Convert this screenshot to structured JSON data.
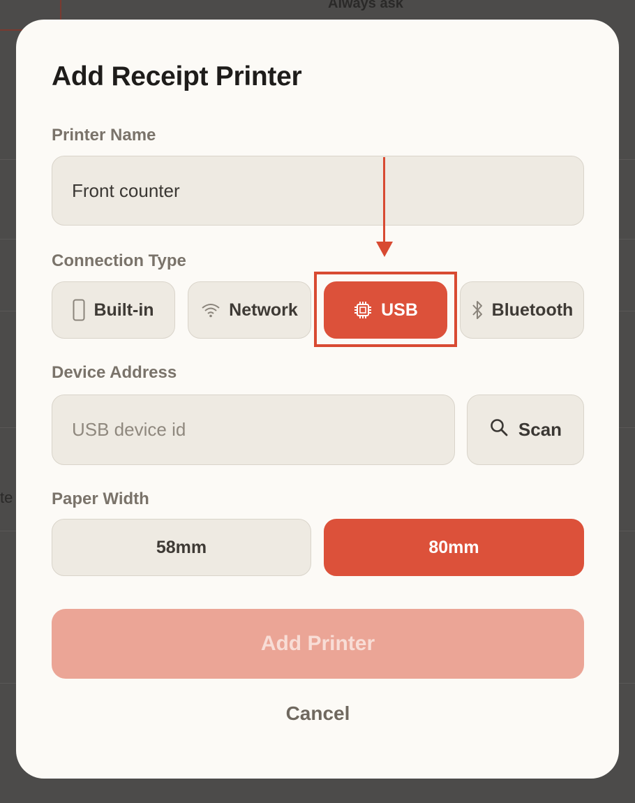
{
  "background": {
    "top_text": "Always ask"
  },
  "dialog": {
    "title": "Add Receipt Printer",
    "printer_name": {
      "label": "Printer Name",
      "value": "Front counter"
    },
    "connection_type": {
      "label": "Connection Type",
      "options": [
        {
          "label": "Built-in",
          "icon": "phone-icon",
          "selected": false
        },
        {
          "label": "Network",
          "icon": "wifi-icon",
          "selected": false
        },
        {
          "label": "USB",
          "icon": "chip-icon",
          "selected": true
        },
        {
          "label": "Bluetooth",
          "icon": "bluetooth-icon",
          "selected": false
        }
      ]
    },
    "device_address": {
      "label": "Device Address",
      "placeholder": "USB device id",
      "value": "",
      "scan_label": "Scan"
    },
    "paper_width": {
      "label": "Paper Width",
      "options": [
        {
          "label": "58mm",
          "selected": false
        },
        {
          "label": "80mm",
          "selected": true
        }
      ]
    },
    "add_label": "Add Printer",
    "cancel_label": "Cancel"
  },
  "colors": {
    "accent": "#dc513a",
    "accent_disabled": "#eba596",
    "annotation": "#d84a32"
  }
}
